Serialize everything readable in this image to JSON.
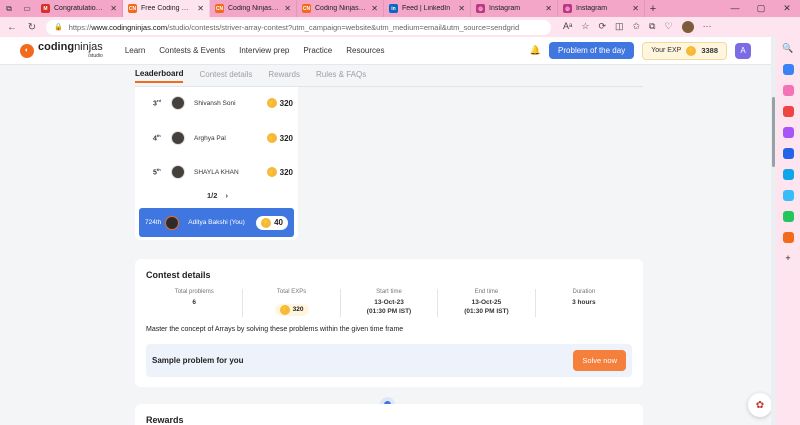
{
  "browser": {
    "tabs": [
      {
        "title": "Congratulations Adi",
        "icon": "gmail-icon",
        "color": "#d93025",
        "glyph": "M",
        "active": false
      },
      {
        "title": "Free Coding Compe",
        "icon": "codingninjas-icon",
        "color": "#f26b1d",
        "glyph": "CN",
        "active": true
      },
      {
        "title": "Coding Ninjas Studio",
        "icon": "codingninjas-icon",
        "color": "#f26b1d",
        "glyph": "CN",
        "active": false
      },
      {
        "title": "Coding Ninjas Studio",
        "icon": "codingninjas-icon",
        "color": "#f26b1d",
        "glyph": "CN",
        "active": false
      },
      {
        "title": "Feed | LinkedIn",
        "icon": "linkedin-icon",
        "color": "#0a66c2",
        "glyph": "in",
        "active": false
      },
      {
        "title": "Instagram",
        "icon": "instagram-icon",
        "color": "#c13584",
        "glyph": "◎",
        "active": false
      },
      {
        "title": "Instagram",
        "icon": "instagram-icon",
        "color": "#c13584",
        "glyph": "◎",
        "active": false
      }
    ],
    "url_prefix": "https://",
    "url_host": "www.codingninjas.com",
    "url_path": "/studio/contests/striver-array-contest?utm_campaign=website&utm_medium=email&utm_source=sendgrid",
    "colors": {
      "tabstrip": "#f3a6c8",
      "toolbar": "#fde4ef"
    }
  },
  "header": {
    "logo_main": "coding",
    "logo_accent": "ninjas",
    "logo_sub": "/studio",
    "nav": [
      "Learn",
      "Contests & Events",
      "Interview prep",
      "Practice",
      "Resources"
    ],
    "problem_of_day": "Problem of the day",
    "exp_label": "Your EXP",
    "exp_value": "3388",
    "user_initial": "A"
  },
  "content_tabs": [
    "Leaderboard",
    "Contest details",
    "Rewards",
    "Rules & FAQs"
  ],
  "leaderboard": {
    "rows": [
      {
        "rank": "3",
        "suffix": "rd",
        "name": "Shivansh Soni",
        "points": "320"
      },
      {
        "rank": "4",
        "suffix": "th",
        "name": "Arghya Pal",
        "points": "320"
      },
      {
        "rank": "5",
        "suffix": "th",
        "name": "SHAYLA KHAN",
        "points": "320"
      }
    ],
    "pager": "1/2",
    "pager_next": "›",
    "you": {
      "rank": "724th",
      "name": "Aditya Bakshi (You)",
      "points": "40"
    }
  },
  "contest_details": {
    "title": "Contest details",
    "stats": [
      {
        "label": "Total problems",
        "value": "6"
      },
      {
        "label": "Total EXPs",
        "value": "320"
      },
      {
        "label": "Start time",
        "value": "13-Oct-23",
        "sub": "(01:30 PM IST)"
      },
      {
        "label": "End time",
        "value": "13-Oct-25",
        "sub": "(01:30 PM IST)"
      },
      {
        "label": "Duration",
        "value": "3 hours"
      }
    ],
    "description": "Master the concept of Arrays by solving these problems within the given time frame",
    "sample_label": "Sample problem for you",
    "solve_button": "Solve now"
  },
  "rewards": {
    "title": "Rewards"
  },
  "theme": {
    "accent": "#f26b1d",
    "primary": "#3f76e0",
    "coin": "#f5b83c"
  }
}
